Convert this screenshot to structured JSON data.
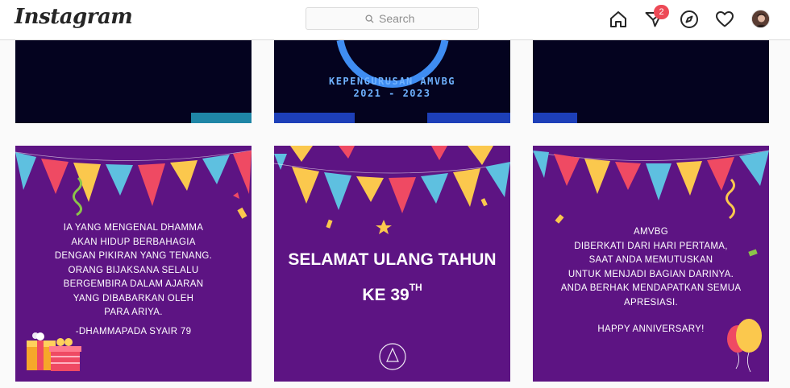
{
  "header": {
    "logo": "Instagram",
    "search_placeholder": "Search",
    "notification_count": "2"
  },
  "icons": [
    "home-icon",
    "direct-icon",
    "explore-icon",
    "activity-heart-icon",
    "profile-avatar"
  ],
  "colors": {
    "accent_badge": "#ed4956",
    "tile_purple": "#5d1483",
    "tile_dark": "#04031f",
    "neon_blue": "#6fb2ff"
  },
  "posts": {
    "row1": {
      "post2_title": "KEPENGURUSAN AMVBG",
      "post2_years": "2021 - 2023"
    },
    "row2": {
      "post1_lines": [
        "Ia yang mengenal Dhamma",
        "akan hidup berbahagia",
        "dengan pikiran yang tenang.",
        "Orang bijaksana selalu",
        "bergembira dalam ajaran",
        "yang dibabarkan oleh",
        "para Ariya.",
        "-Dhammapada syair 79"
      ],
      "post2_line1": "Selamat Ulang Tahun",
      "post2_line2": "ke 39",
      "post2_sup": "TH",
      "post3_lines": [
        "AMVBG",
        "diberkati dari hari pertama,",
        "saat Anda memutuskan",
        "untuk menjadi bagian darinya.",
        "Anda berhak mendapatkan semua",
        "apresiasi.",
        "Happy anniversary!"
      ]
    }
  }
}
